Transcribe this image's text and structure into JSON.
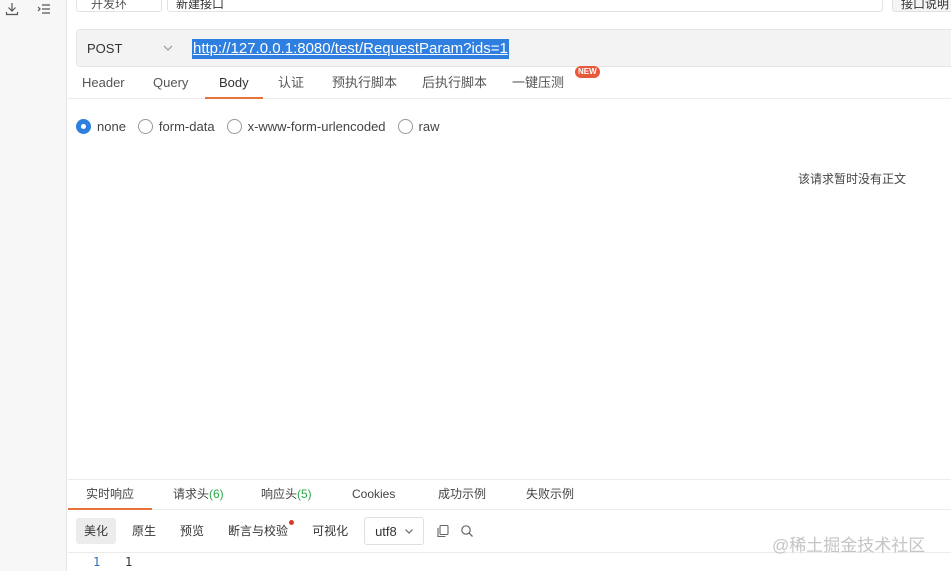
{
  "sidebar": {
    "icons": [
      "download-icon",
      "list-indent-icon"
    ]
  },
  "top_row": {
    "env_label": "开发环",
    "name_value": "新建接口",
    "save_button_label": "接口说明"
  },
  "request": {
    "method": "POST",
    "url": "http://127.0.0.1:8080/test/RequestParam?ids=1"
  },
  "request_tabs": [
    {
      "label": "Header",
      "active": false
    },
    {
      "label": "Query",
      "active": false
    },
    {
      "label": "Body",
      "active": true
    },
    {
      "label": "认证",
      "active": false
    },
    {
      "label": "预执行脚本",
      "active": false
    },
    {
      "label": "后执行脚本",
      "active": false
    },
    {
      "label": "一键压测",
      "active": false
    }
  ],
  "new_badge": "NEW",
  "body_types": [
    {
      "label": "none",
      "checked": true
    },
    {
      "label": "form-data",
      "checked": false
    },
    {
      "label": "x-www-form-urlencoded",
      "checked": false
    },
    {
      "label": "raw",
      "checked": false
    }
  ],
  "body_empty_message": "该请求暂时没有正文",
  "response": {
    "tabs": [
      {
        "label": "实时响应",
        "count": "",
        "active": true
      },
      {
        "label": "请求头",
        "count": "(6)",
        "active": false
      },
      {
        "label": "响应头",
        "count": "(5)",
        "active": false
      },
      {
        "label": "Cookies",
        "count": "",
        "active": false
      },
      {
        "label": "成功示例",
        "count": "",
        "active": false
      },
      {
        "label": "失败示例",
        "count": "",
        "active": false
      }
    ],
    "toolbar": {
      "beautify": "美化",
      "raw": "原生",
      "preview": "预览",
      "assert": "断言与校验",
      "visualize": "可视化",
      "encoding": "utf8"
    },
    "lines": [
      {
        "no": "1",
        "text": "1"
      }
    ]
  },
  "watermark": "@稀土掘金技术社区",
  "colors": {
    "accent": "#e8733a",
    "selection": "#2f7fe0",
    "count_green": "#2aa84a",
    "badge_red": "#e8583a"
  }
}
